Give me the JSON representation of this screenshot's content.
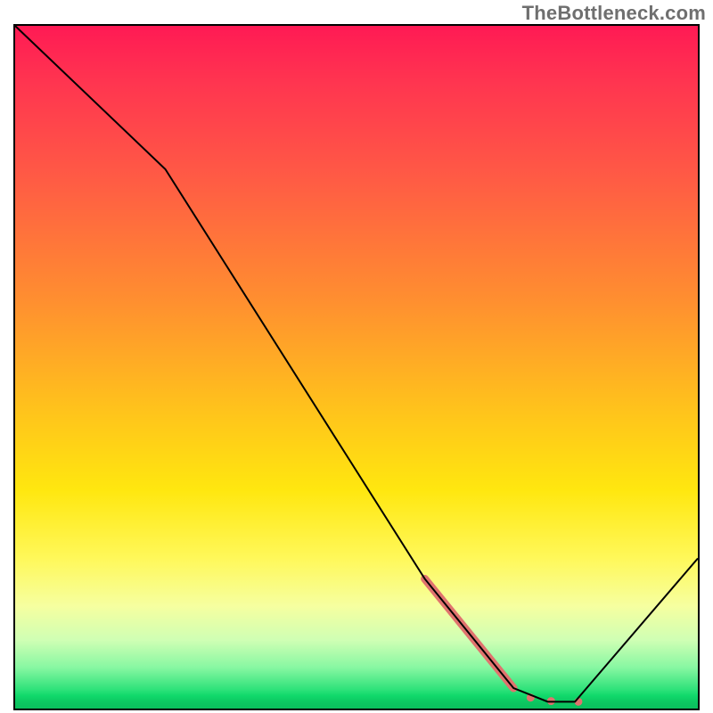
{
  "watermark": "TheBottleneck.com",
  "chart_data": {
    "type": "line",
    "title": "",
    "xlabel": "",
    "ylabel": "",
    "xlim": [
      0,
      100
    ],
    "ylim": [
      0,
      100
    ],
    "grid": false,
    "legend": false,
    "series": [
      {
        "name": "curve",
        "x": [
          0,
          22,
          60,
          73,
          78,
          82,
          100
        ],
        "y": [
          100,
          79,
          19,
          3,
          1,
          1,
          22
        ],
        "color": "#000000",
        "stroke_width": 2
      }
    ],
    "highlight": {
      "name": "highlight-band",
      "color": "#e0736e",
      "segment": {
        "x": [
          60,
          73
        ],
        "y": [
          19,
          3
        ],
        "stroke_width": 9
      },
      "dots": [
        {
          "x": 75.5,
          "y": 1.6,
          "r": 4.5
        },
        {
          "x": 78.5,
          "y": 1.1,
          "r": 4.5
        },
        {
          "x": 82.5,
          "y": 1.0,
          "r": 4.5
        }
      ]
    },
    "background": {
      "type": "vertical-gradient",
      "stops": [
        {
          "pos": 0.0,
          "color": "#ff1a54"
        },
        {
          "pos": 0.4,
          "color": "#ff8e30"
        },
        {
          "pos": 0.68,
          "color": "#ffe70f"
        },
        {
          "pos": 0.9,
          "color": "#cfffb4"
        },
        {
          "pos": 0.98,
          "color": "#11d96b"
        },
        {
          "pos": 1.0,
          "color": "#0abf5d"
        }
      ]
    }
  }
}
